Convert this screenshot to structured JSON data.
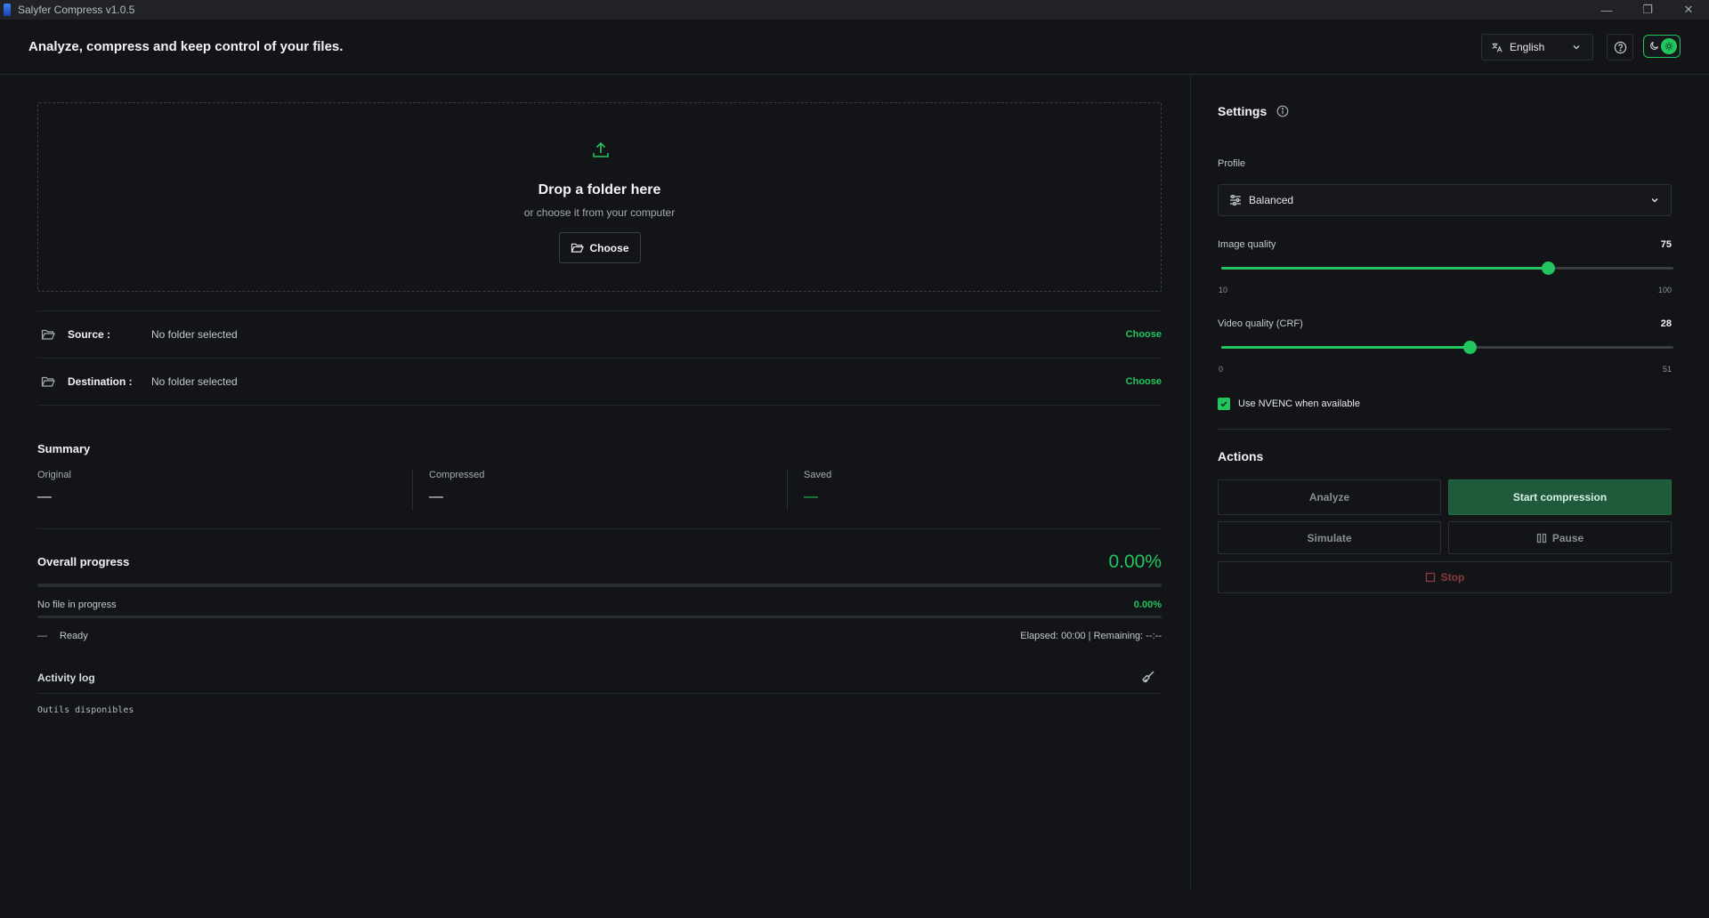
{
  "window": {
    "title": "Salyfer Compress v1.0.5",
    "controls": {
      "minimize": "—",
      "restore": "❐",
      "close": "✕"
    }
  },
  "header": {
    "tagline": "Analyze, compress and keep control of your files.",
    "language": "English",
    "theme_icons": {
      "moon": "moon-icon",
      "sun": "sun-icon"
    }
  },
  "dropzone": {
    "title": "Drop a folder here",
    "subtitle": "or choose it from your computer",
    "button": "Choose"
  },
  "paths": [
    {
      "label": "Source :",
      "value": "No folder selected",
      "action": "Choose"
    },
    {
      "label": "Destination :",
      "value": "No folder selected",
      "action": "Choose"
    }
  ],
  "summary": {
    "title": "Summary",
    "original_label": "Original",
    "original_value": "—",
    "compressed_label": "Compressed",
    "compressed_value": "—",
    "saved_label": "Saved",
    "saved_value": "—"
  },
  "progress": {
    "title": "Overall progress",
    "overall_percent": "0.00%",
    "overall_fraction": 0,
    "file_text": "No file in progress",
    "file_percent": "0.00%",
    "file_fraction": 0,
    "status_dash": "—",
    "status": "Ready",
    "timing": "Elapsed: 00:00 | Remaining: --:--"
  },
  "activity_log": {
    "title": "Activity log",
    "lines": [
      "Outils disponibles"
    ]
  },
  "settings": {
    "title": "Settings",
    "profile_label": "Profile",
    "profile_value": "Balanced",
    "image_quality": {
      "label": "Image quality",
      "value": "75",
      "min": "10",
      "max": "100",
      "fraction": 0.722
    },
    "video_quality": {
      "label": "Video quality (CRF)",
      "value": "28",
      "min": "0",
      "max": "51",
      "fraction": 0.549
    },
    "nvenc_label": "Use NVENC when available",
    "nvenc_checked": true
  },
  "actions": {
    "title": "Actions",
    "analyze": "Analyze",
    "start": "Start compression",
    "simulate": "Simulate",
    "pause": "Pause",
    "stop": "Stop"
  },
  "colors": {
    "accent": "#22c55e",
    "background": "#121417",
    "primary_button": "#1f5a3a",
    "stop": "#8b3a3f"
  }
}
